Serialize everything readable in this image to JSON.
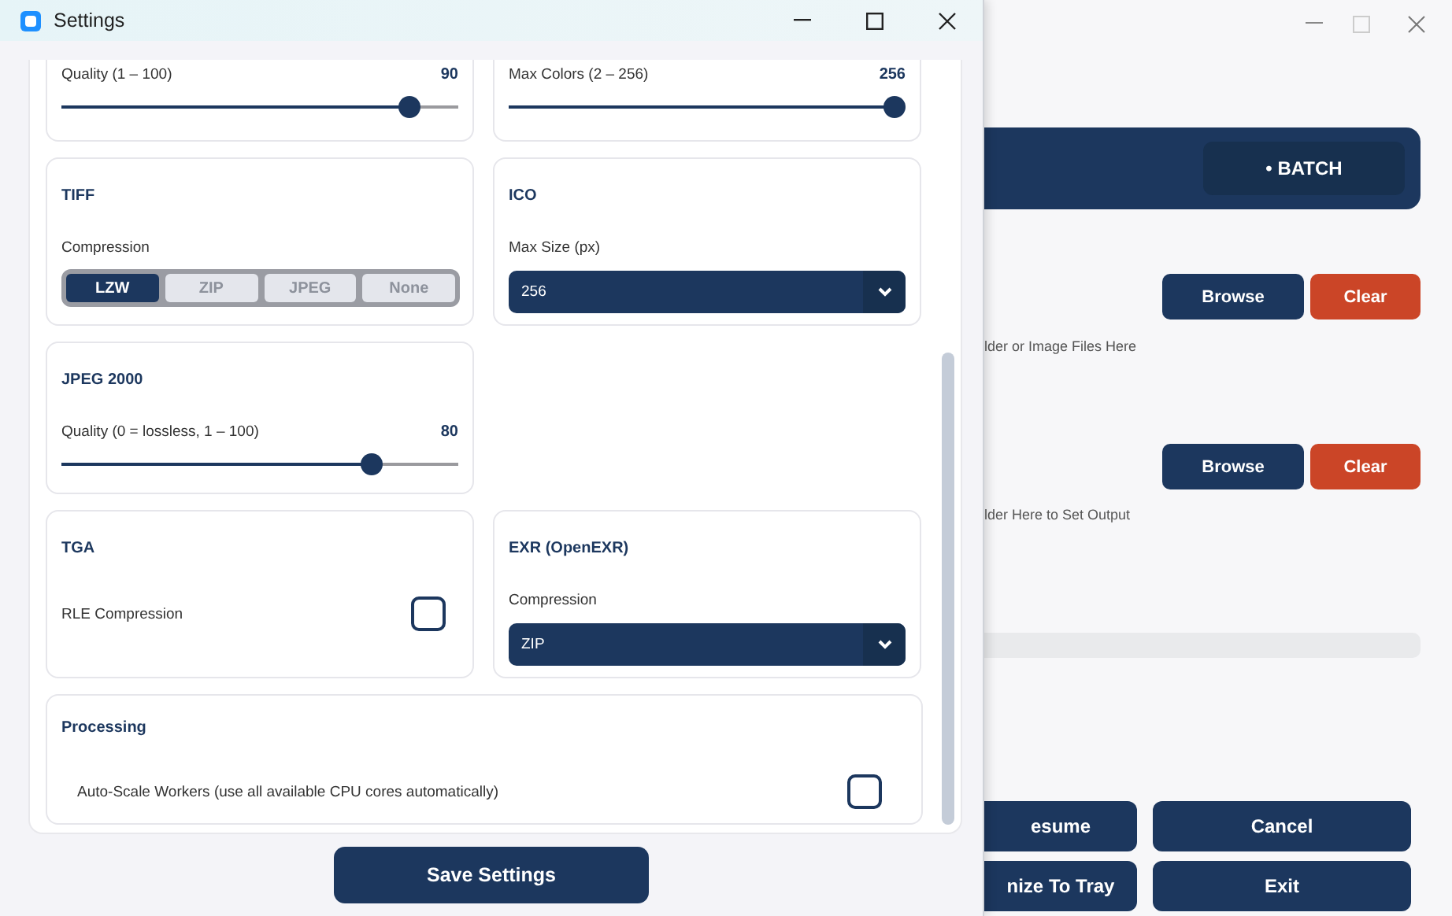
{
  "settings_window": {
    "title": "Settings",
    "rows": [
      [
        {
          "kind": "slider",
          "label": "Quality  (1 – 100)",
          "reading": "90",
          "level": 0.9
        },
        {
          "kind": "slider",
          "label": "Max Colors  (2 – 256)",
          "reading": "256",
          "level": 1
        }
      ],
      [
        {
          "kind": "segmented",
          "title": "TIFF",
          "label": "Compression",
          "options": [
            {
              "label": "LZW",
              "selected": true
            },
            {
              "label": "ZIP",
              "selected": false
            },
            {
              "label": "JPEG",
              "selected": false
            },
            {
              "label": "None",
              "selected": false
            }
          ]
        },
        {
          "kind": "dropdown",
          "title": "ICO",
          "label": "Max Size (px)",
          "value": "256"
        }
      ],
      [
        {
          "kind": "slider",
          "title": "JPEG 2000",
          "label": "Quality  (0 = lossless, 1 – 100)",
          "reading": "80",
          "level": 0.8
        }
      ],
      [
        {
          "kind": "checkbox",
          "title": "TGA",
          "label": "RLE Compression",
          "checked": false
        },
        {
          "kind": "dropdown",
          "title": "EXR  (OpenEXR)",
          "label": "Compression",
          "value": "ZIP"
        }
      ]
    ],
    "processing": {
      "title": "Processing",
      "label": "Auto-Scale Workers  (use all available CPU cores automatically)",
      "checked": false
    },
    "save_button": "Save Settings"
  },
  "main_window": {
    "mode_badge": "• BATCH",
    "input_row": {
      "browse": "Browse",
      "clear": "Clear",
      "hint": "lder or Image Files Here"
    },
    "output_row": {
      "browse": "Browse",
      "clear": "Clear",
      "hint": "lder Here to Set Output"
    },
    "progress": {
      "level": 0
    },
    "buttons": [
      [
        "esume",
        "Cancel"
      ],
      [
        "nize To Tray",
        "Exit"
      ]
    ]
  }
}
